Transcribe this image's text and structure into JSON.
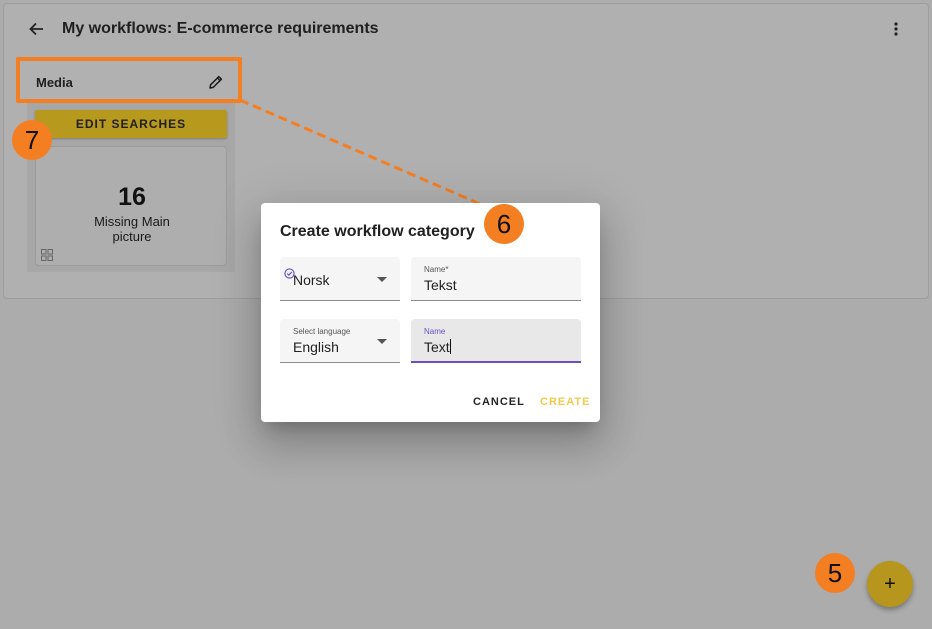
{
  "header": {
    "title": "My workflows: E-commerce requirements"
  },
  "category": {
    "name": "Media",
    "edit_searches_label": "EDIT SEARCHES",
    "stat": {
      "count": "16",
      "label": "Missing Main picture"
    }
  },
  "dialog": {
    "title": "Create workflow category",
    "row1": {
      "language": "Norsk",
      "name_label": "Name*",
      "name_value": "Tekst"
    },
    "row2": {
      "language_label": "Select language",
      "language": "English",
      "name_label": "Name",
      "name_value": "Text"
    },
    "cancel_label": "CANCEL",
    "create_label": "CREATE"
  },
  "fab": {
    "label": "+"
  },
  "annotations": {
    "step5": "5",
    "step6": "6",
    "step7": "7"
  },
  "colors": {
    "accent": "#f47e22",
    "gold": "#b79a1d",
    "create_disabled": "#f2c94c",
    "focus": "#6a4fc8"
  },
  "icons": [
    "back-arrow-icon",
    "more-vert-icon",
    "pencil-icon",
    "grid-icon",
    "verified-icon",
    "dropdown-arrow-icon",
    "plus-icon"
  ]
}
